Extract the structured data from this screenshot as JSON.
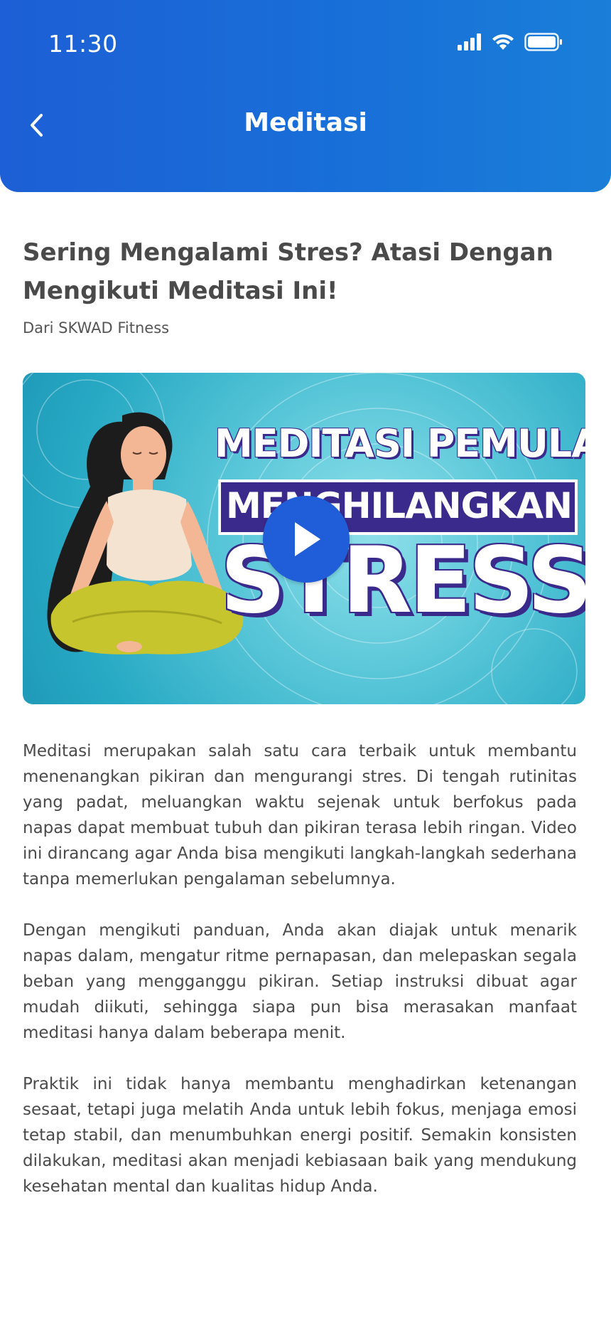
{
  "status_bar": {
    "time": "11:30",
    "icons": [
      "signal-icon",
      "wifi-icon",
      "battery-icon"
    ]
  },
  "header": {
    "back_icon": "chevron-left-icon",
    "title": "Meditasi"
  },
  "article": {
    "title": "Sering Mengalami Stres? Atasi Dengan Mengikuti Meditasi Ini!",
    "source": "Dari SKWAD Fitness",
    "video": {
      "line1": "MEDITASI PEMULA",
      "line2": "MENGHILANGKAN",
      "line3": "STRESS",
      "play_icon": "play-icon"
    },
    "paragraphs": [
      "Meditasi merupakan salah satu cara terbaik untuk membantu menenangkan pikiran dan mengurangi stres. Di tengah rutinitas yang padat, meluangkan waktu sejenak untuk berfokus pada napas dapat membuat tubuh dan pikiran terasa lebih ringan. Video ini dirancang agar Anda bisa mengikuti langkah-langkah sederhana tanpa memerlukan pengalaman sebelumnya.",
      "Dengan mengikuti panduan, Anda akan diajak untuk menarik napas dalam, mengatur ritme pernapasan, dan melepaskan segala beban yang mengganggu pikiran. Setiap instruksi dibuat agar mudah diikuti, sehingga siapa pun bisa merasakan manfaat meditasi hanya dalam beberapa menit.",
      "Praktik ini tidak hanya membantu menghadirkan ketenangan sesaat, tetapi juga melatih Anda untuk lebih fokus, menjaga emosi tetap stabil, dan menumbuhkan energi positif. Semakin konsisten dilakukan, meditasi akan menjadi kebiasaan baik yang mendukung kesehatan mental dan kualitas hidup Anda."
    ]
  },
  "colors": {
    "header_blue": "#1d66d8",
    "text_dark": "#4a4a4a",
    "thumbnail_teal": "#3db8cf",
    "thumbnail_purple": "#3a2a8c",
    "play_blue": "#1f5ed8"
  }
}
